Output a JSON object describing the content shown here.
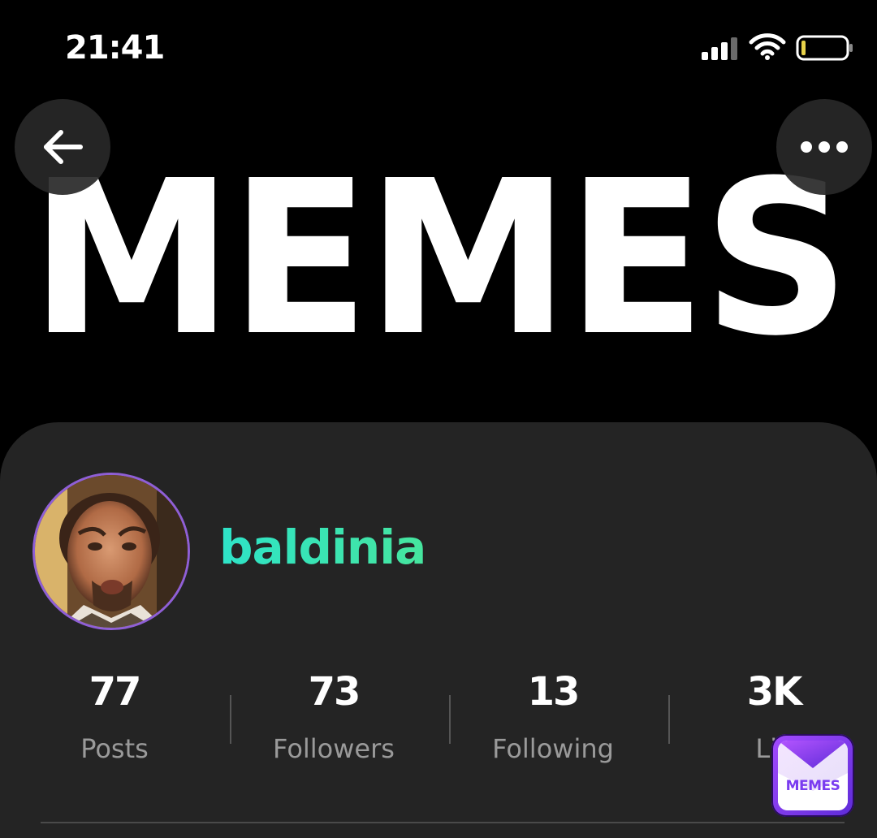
{
  "status_bar": {
    "time": "21:41"
  },
  "header": {
    "banner_text": "MEMES",
    "back_icon": "arrow-left-icon",
    "more_icon": "ellipsis-icon"
  },
  "profile": {
    "username": "baldinia",
    "stats": [
      {
        "value": "77",
        "label": "Posts"
      },
      {
        "value": "73",
        "label": "Followers"
      },
      {
        "value": "13",
        "label": "Following"
      },
      {
        "value": "3K",
        "label": "Lik"
      }
    ]
  },
  "watermark": {
    "text": "MEMES"
  },
  "colors": {
    "background": "#000000",
    "card": "#242424",
    "username_gradient_start": "#2ee3c8",
    "username_gradient_end": "#46e59e",
    "avatar_ring": "#8f5fd6",
    "stat_label": "#9a9a9a",
    "badge": "#7a3cf0"
  }
}
